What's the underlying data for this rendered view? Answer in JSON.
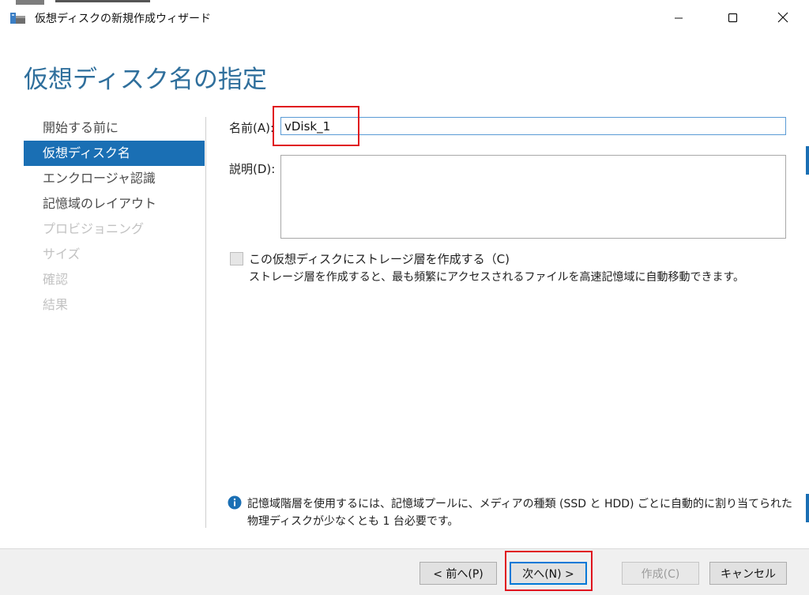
{
  "window": {
    "title": "仮想ディスクの新規作成ウィザード"
  },
  "page": {
    "heading": "仮想ディスク名の指定"
  },
  "nav": {
    "items": [
      {
        "label": "開始する前に",
        "state": "done"
      },
      {
        "label": "仮想ディスク名",
        "state": "active"
      },
      {
        "label": "エンクロージャ認識",
        "state": "done"
      },
      {
        "label": "記憶域のレイアウト",
        "state": "done"
      },
      {
        "label": "プロビジョニング",
        "state": "disabled"
      },
      {
        "label": "サイズ",
        "state": "disabled"
      },
      {
        "label": "確認",
        "state": "disabled"
      },
      {
        "label": "結果",
        "state": "disabled"
      }
    ]
  },
  "form": {
    "name_label": "名前(A):",
    "name_value": "vDisk_1",
    "description_label": "説明(D):",
    "description_value": "",
    "tier_checkbox_label": "この仮想ディスクにストレージ層を作成する（C)",
    "tier_checked": false,
    "tier_description": "ストレージ層を作成すると、最も頻繁にアクセスされるファイルを高速記憶域に自動移動できます。"
  },
  "info": {
    "line1": "記憶域階層を使用するには、記憶域プールに、メディアの種類 (SSD と HDD) ごとに自動的に割り当てられた",
    "line2": "物理ディスクが少なくとも 1 台必要です。"
  },
  "buttons": {
    "back": "< 前へ(P)",
    "next": "次へ(N) >",
    "create": "作成(C)",
    "cancel": "キャンセル"
  },
  "colors": {
    "accent": "#1a6fb4",
    "heading": "#2f6f9c",
    "highlight": "#e0141e"
  },
  "icons": {
    "app": "storage-wizard-icon",
    "info": "info-icon",
    "minimize": "minimize-icon",
    "maximize": "maximize-icon",
    "close": "close-icon"
  }
}
